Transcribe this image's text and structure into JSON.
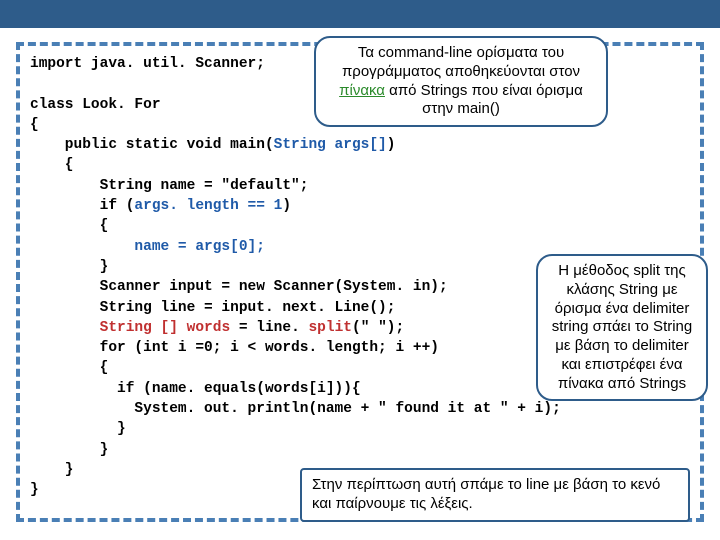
{
  "code": {
    "l1": "import java. util. Scanner;",
    "l2": "",
    "l3": "class Look. For",
    "l4": "{",
    "l5": "    public static void main(",
    "l5b": "String args[]",
    "l5c": ")",
    "l6": "    {",
    "l7": "        String name = \"default\";",
    "l8": "        if (",
    "l8b": "args. length == 1",
    "l8c": ")",
    "l9": "        {",
    "l10": "            ",
    "l10b": "name = args[0];",
    "l11": "        }",
    "l12": "        Scanner input = new Scanner(System. in);",
    "l13": "        String line = input. next. Line();",
    "l14a": "        ",
    "l14b": "String [] words",
    "l14c": " = line. ",
    "l14d": "split",
    "l14e": "(\" \");",
    "l15": "        for (int i =0; i < words. length; i ++)",
    "l16": "        {",
    "l17": "          if (name. equals(words[i])){",
    "l18": "            System. out. println(name + \" found it at \" + i);",
    "l19": "          }",
    "l20": "        }",
    "l21": "    }",
    "l22": "}"
  },
  "callouts": {
    "top_a": "Τα command-line ορίσματα του προγράμματος αποθηκεύονται στον ",
    "top_b": "πίνακα",
    "top_c": " από Strings που είναι όρισμα στην main()",
    "right": "Η μέθοδος split της κλάσης String με όρισμα ένα delimiter string σπάει το String με βάση το delimiter και επιστρέφει ένα πίνακα από Strings",
    "bottom": "Στην περίπτωση αυτή σπάμε το line με βάση το κενό και παίρνουμε τις λέξεις."
  }
}
